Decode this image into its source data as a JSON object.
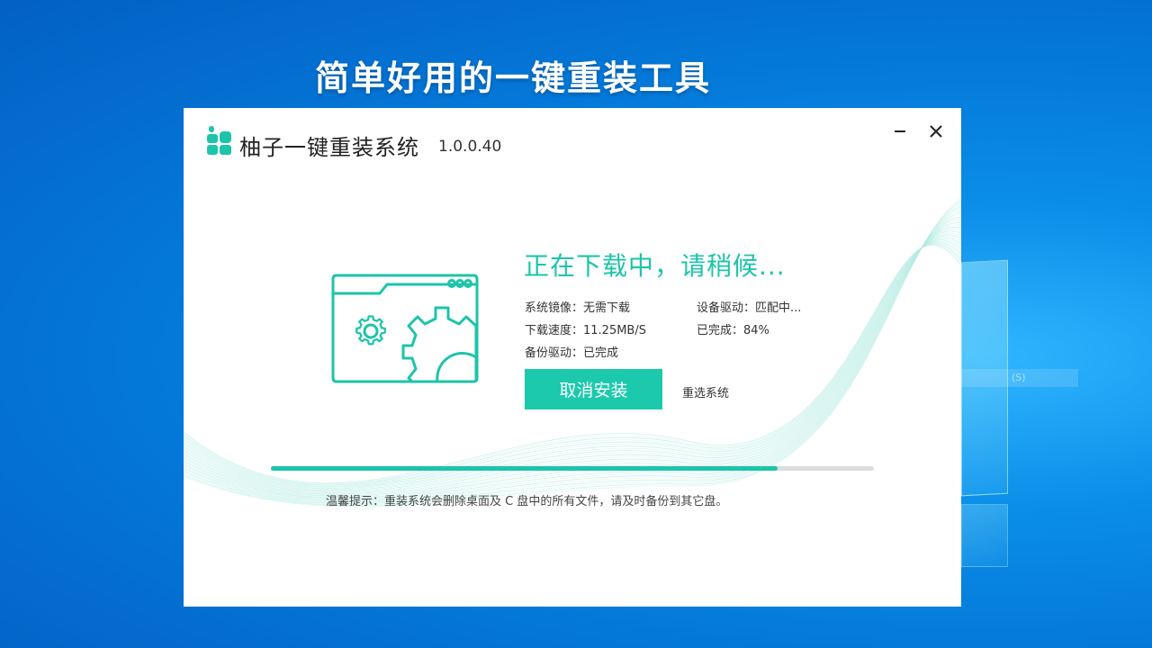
{
  "desktop": {
    "headline": "简单好用的一键重装工具",
    "ghost_text": "(S)"
  },
  "window": {
    "title": "柚子一键重装系统",
    "version": "1.0.0.40",
    "minimize_icon": "minimize-icon",
    "close_icon": "close-icon"
  },
  "status": {
    "title": "正在下载中，请稍候...",
    "system_image": "系统镜像：无需下载",
    "device_driver": "设备驱动：匹配中...",
    "download_speed": "下载速度：11.25MB/S",
    "completed": "已完成：84%",
    "backup_driver": "备份驱动：已完成",
    "progress_percent": 84
  },
  "actions": {
    "cancel_label": "取消安装",
    "reselect_label": "重选系统"
  },
  "tip": "温馨提示：重装系统会删除桌面及 C 盘中的所有文件，请及时备份到其它盘。",
  "colors": {
    "accent": "#1cc4aa",
    "button": "#1cc9ad",
    "desktop_blue": "#0478d8"
  },
  "icons": {
    "logo": "pomelo-logo-icon",
    "illustration": "folder-gear-icon"
  }
}
